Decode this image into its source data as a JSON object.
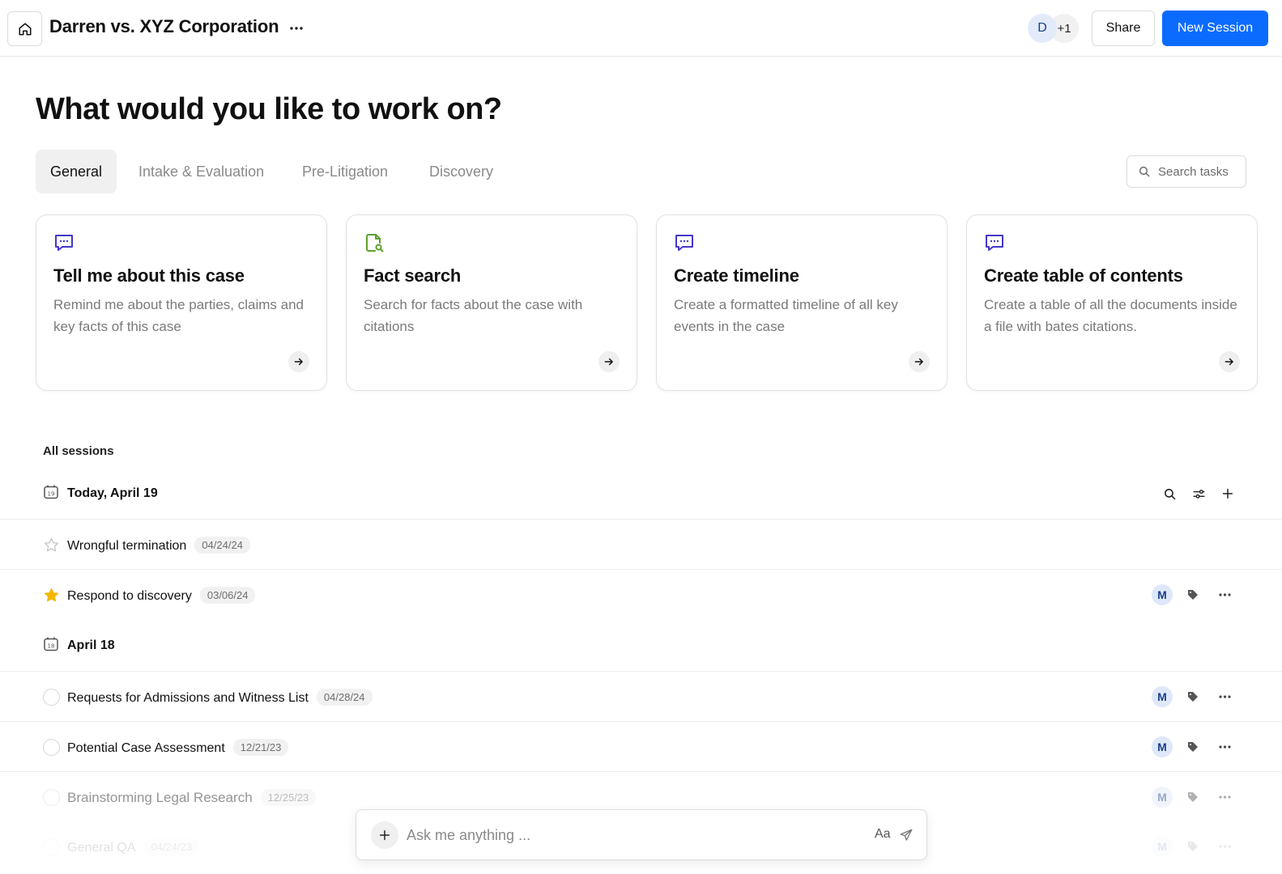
{
  "header": {
    "title": "Darren vs. XYZ Corporation",
    "avatar_initial": "D",
    "avatar_more": "+1",
    "share_label": "Share",
    "new_session_label": "New Session"
  },
  "main": {
    "heading": "What would you like to work on?",
    "tabs": [
      {
        "label": "General",
        "active": true
      },
      {
        "label": "Intake & Evaluation",
        "active": false
      },
      {
        "label": "Pre-Litigation",
        "active": false
      },
      {
        "label": "Discovery",
        "active": false
      }
    ],
    "search_tasks_placeholder": "Search tasks",
    "cards": [
      {
        "icon": "chat-bubble-icon",
        "title": "Tell me about this case",
        "desc": "Remind me about the parties, claims and key facts of this case"
      },
      {
        "icon": "document-search-icon",
        "title": "Fact search",
        "desc": "Search for facts about the case with citations"
      },
      {
        "icon": "chat-bubble-icon",
        "title": "Create timeline",
        "desc": "Create a formatted timeline of all key events in the case"
      },
      {
        "icon": "chat-bubble-icon",
        "title": "Create table of contents",
        "desc": "Create a table of all the documents inside a file with bates citations."
      }
    ]
  },
  "sessions": {
    "heading": "All sessions",
    "groups": [
      {
        "label": "Today, April 19",
        "cal_day": "19",
        "items": [
          {
            "name": "Wrongful termination",
            "date": "04/24/24",
            "lead": "star-outline",
            "assignee": ""
          },
          {
            "name": "Respond to discovery",
            "date": "03/06/24",
            "lead": "star-filled",
            "assignee": "M"
          }
        ]
      },
      {
        "label": "April 18",
        "cal_day": "18",
        "items": [
          {
            "name": "Requests for Admissions and Witness List",
            "date": "04/28/24",
            "lead": "circle",
            "assignee": "M"
          },
          {
            "name": "Potential Case Assessment",
            "date": "12/21/23",
            "lead": "circle",
            "assignee": "M"
          },
          {
            "name": "Brainstorming Legal Research",
            "date": "12/25/23",
            "lead": "circle",
            "assignee": "M"
          },
          {
            "name": "General QA",
            "date": "04/24/23",
            "lead": "circle",
            "assignee": "M"
          }
        ]
      }
    ]
  },
  "ask": {
    "placeholder": "Ask me anything ...",
    "format_label": "Aa"
  },
  "colors": {
    "primary": "#0b6bff",
    "icon_purple": "#4338ca",
    "icon_green": "#5aa02c",
    "star": "#f5b700"
  }
}
